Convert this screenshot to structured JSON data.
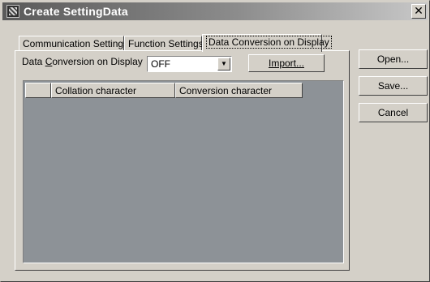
{
  "window": {
    "title": "Create SettingData",
    "close_glyph": "✕",
    "icon": "app-icon"
  },
  "tabs": [
    {
      "label": "Communication Settings",
      "active": false
    },
    {
      "label": "Function Settings",
      "active": false
    },
    {
      "label": "Data Conversion on Display",
      "active": true
    }
  ],
  "panel": {
    "conversion_label_prefix": "Data ",
    "conversion_label_accel": "C",
    "conversion_label_rest": "onversion on Display",
    "conversion_value": "OFF",
    "dropdown_glyph": "▼",
    "import_button": "Import..."
  },
  "table": {
    "columns": [
      "",
      "Collation character",
      "Conversion character"
    ],
    "rows": []
  },
  "side_buttons": {
    "open": "Open...",
    "save": "Save...",
    "cancel": "Cancel"
  }
}
